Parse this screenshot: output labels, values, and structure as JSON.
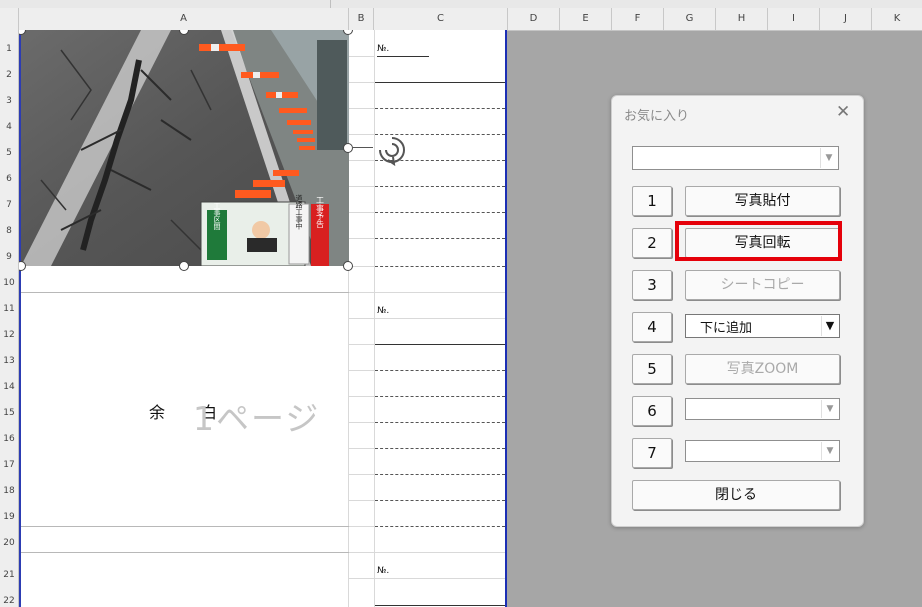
{
  "columns": [
    "A",
    "B",
    "C",
    "D",
    "E",
    "F",
    "G",
    "H",
    "I",
    "J",
    "K"
  ],
  "rows": [
    "1",
    "2",
    "3",
    "4",
    "5",
    "6",
    "7",
    "8",
    "9",
    "10",
    "11",
    "12",
    "13",
    "14",
    "15",
    "16",
    "17",
    "18",
    "19",
    "20",
    "21",
    "22"
  ],
  "sheet": {
    "no_label": "№.",
    "margin_left": "余",
    "margin_right": "白",
    "page_watermark": "1ページ"
  },
  "photo": {
    "sign_red": "工事予告",
    "sign_white": "道路工事中",
    "sign_green": "工事区間"
  },
  "dialog": {
    "title": "お気に入り",
    "close_glyph": "✕",
    "top_combo_value": "",
    "rows": [
      {
        "num": "1",
        "label": "写真貼付",
        "type": "button",
        "enabled": true
      },
      {
        "num": "2",
        "label": "写真回転",
        "type": "button",
        "enabled": true
      },
      {
        "num": "3",
        "label": "シートコピー",
        "type": "button",
        "enabled": false
      },
      {
        "num": "4",
        "label": "下に追加",
        "type": "combo"
      },
      {
        "num": "5",
        "label": "写真ZOOM",
        "type": "button",
        "enabled": false
      },
      {
        "num": "6",
        "label": "",
        "type": "combo"
      },
      {
        "num": "7",
        "label": "",
        "type": "combo"
      }
    ],
    "close_button": "閉じる"
  },
  "colors": {
    "highlight": "#e5000a",
    "page_border": "#1c2fb5",
    "background": "#a6a6a6"
  }
}
